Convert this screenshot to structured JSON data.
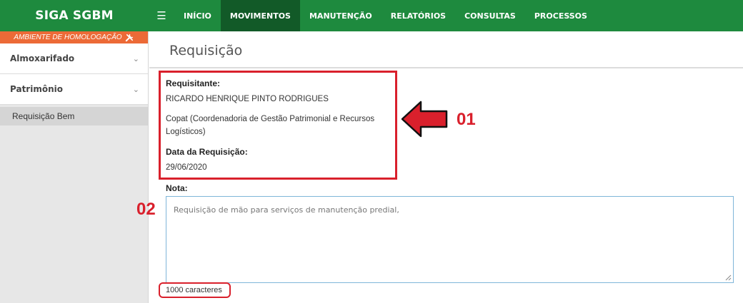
{
  "app": {
    "brand": "SIGA SGBM"
  },
  "topnav": {
    "items": [
      {
        "label": "INÍCIO",
        "active": false
      },
      {
        "label": "MOVIMENTOS",
        "active": true
      },
      {
        "label": "MANUTENÇÃO",
        "active": false
      },
      {
        "label": "RELATÓRIOS",
        "active": false
      },
      {
        "label": "CONSULTAS",
        "active": false
      },
      {
        "label": "PROCESSOS",
        "active": false
      }
    ]
  },
  "sidebar": {
    "environment": "AMBIENTE DE HOMOLOGAÇÃO",
    "groups": [
      {
        "label": "Almoxarifado",
        "icon": "chevron-down-icon"
      },
      {
        "label": "Patrimônio",
        "icon": "chevron-down-icon"
      }
    ],
    "active_item": "Requisição Bem"
  },
  "page": {
    "title": "Requisição"
  },
  "request": {
    "requester_label": "Requisitante:",
    "requester_name": "RICARDO HENRIQUE PINTO RODRIGUES",
    "department_line1": "Copat (Coordenadoria de Gestão Patrimonial e Recursos",
    "department_line2": "Logísticos)",
    "date_label": "Data da Requisição:",
    "date_value": "29/06/2020"
  },
  "note": {
    "label": "Nota:",
    "value": "Requisição de mão para serviços de manutenção predial,",
    "counter": "1000 caracteres"
  },
  "annotations": {
    "first": "01",
    "second": "02"
  },
  "colors": {
    "brand_green": "#1e8a3e",
    "active_green": "#125a28",
    "env_orange": "#ec6a37",
    "annotation_red": "#d9202c"
  }
}
